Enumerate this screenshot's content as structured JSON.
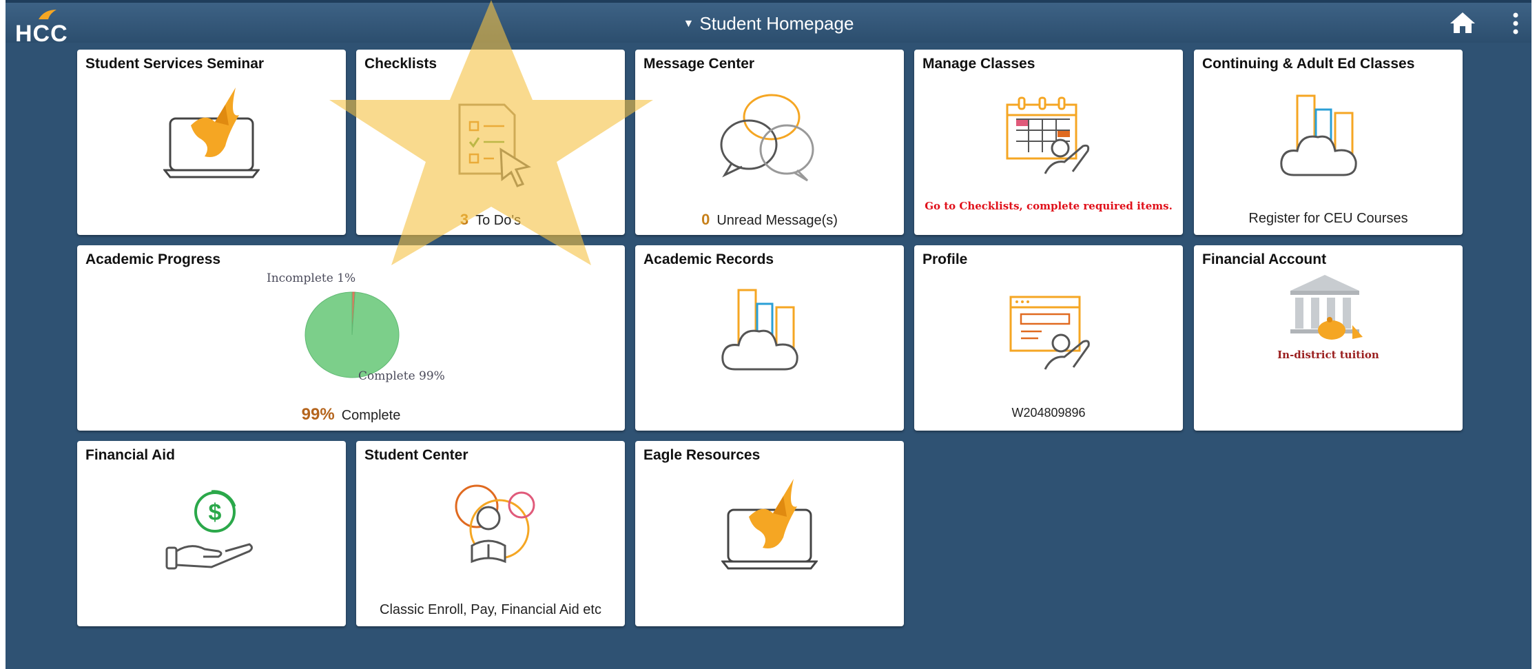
{
  "header": {
    "logo_text": "HCC",
    "title": "Student Homepage"
  },
  "tiles": {
    "student_services_seminar": {
      "title": "Student Services Seminar"
    },
    "checklists": {
      "title": "Checklists",
      "count": "3",
      "count_label": "To Do's"
    },
    "message_center": {
      "title": "Message Center",
      "count": "0",
      "count_label": "Unread Message(s)"
    },
    "manage_classes": {
      "title": "Manage Classes",
      "notice": "Go to Checklists, complete required items."
    },
    "continuing_ed": {
      "title": "Continuing & Adult Ed Classes",
      "footer": "Register for CEU Courses"
    },
    "academic_progress": {
      "title": "Academic Progress",
      "percent": "99%",
      "percent_label": "Complete"
    },
    "academic_records": {
      "title": "Academic Records"
    },
    "profile": {
      "title": "Profile",
      "id": "W204809896"
    },
    "financial_account": {
      "title": "Financial Account",
      "status": "In-district tuition"
    },
    "financial_aid": {
      "title": "Financial Aid"
    },
    "student_center": {
      "title": "Student Center",
      "footer": "Classic Enroll, Pay, Financial Aid etc"
    },
    "eagle_resources": {
      "title": "Eagle Resources"
    }
  },
  "chart_data": {
    "type": "pie",
    "categories": [
      "Incomplete",
      "Complete"
    ],
    "values": [
      1,
      99
    ],
    "labels": [
      "Incomplete 1%",
      "Complete 99%"
    ],
    "colors": [
      "#e07a5f",
      "#7ccf8a"
    ]
  },
  "colors": {
    "background": "#2f5273",
    "accent_orange": "#f5a623",
    "count_brown": "#b5651d",
    "alert_red": "#e0101a"
  },
  "icons": {
    "home": "home-icon",
    "menu": "kebab-menu-icon",
    "eagle": "eagle-laptop-icon",
    "checklist": "checklist-cursor-icon",
    "message": "chat-bubbles-icon",
    "calendar": "calendar-person-icon",
    "cloud": "cloud-city-icon",
    "profile": "profile-card-icon",
    "bank": "bank-icon",
    "money": "dollar-hand-icon",
    "student": "student-reading-icon"
  }
}
